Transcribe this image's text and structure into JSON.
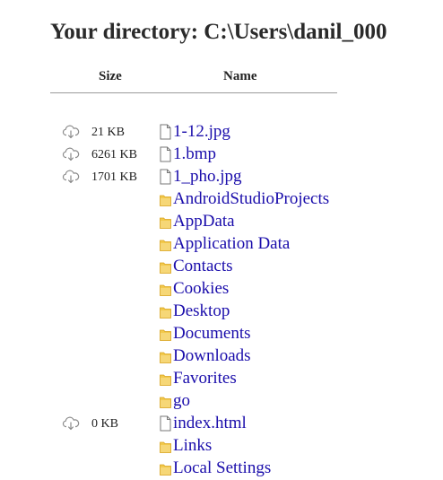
{
  "title": "Your directory: C:\\Users\\danil_000",
  "columns": {
    "size": "Size",
    "name": "Name"
  },
  "colors": {
    "link": "#1a0dab",
    "folder": "#f2c94c",
    "rule": "#9a9a9a"
  },
  "entries": [
    {
      "name": "1-12.jpg",
      "type": "file",
      "size": "21 KB"
    },
    {
      "name": "1.bmp",
      "type": "file",
      "size": "6261 KB"
    },
    {
      "name": "1_pho.jpg",
      "type": "file",
      "size": "1701 KB"
    },
    {
      "name": "AndroidStudioProjects",
      "type": "folder",
      "size": ""
    },
    {
      "name": "AppData",
      "type": "folder",
      "size": ""
    },
    {
      "name": "Application Data",
      "type": "folder",
      "size": ""
    },
    {
      "name": "Contacts",
      "type": "folder",
      "size": ""
    },
    {
      "name": "Cookies",
      "type": "folder",
      "size": ""
    },
    {
      "name": "Desktop",
      "type": "folder",
      "size": ""
    },
    {
      "name": "Documents",
      "type": "folder",
      "size": ""
    },
    {
      "name": "Downloads",
      "type": "folder",
      "size": ""
    },
    {
      "name": "Favorites",
      "type": "folder",
      "size": ""
    },
    {
      "name": "go",
      "type": "folder",
      "size": ""
    },
    {
      "name": "index.html",
      "type": "file",
      "size": "0 KB"
    },
    {
      "name": "Links",
      "type": "folder",
      "size": ""
    },
    {
      "name": "Local Settings",
      "type": "folder",
      "size": ""
    }
  ]
}
